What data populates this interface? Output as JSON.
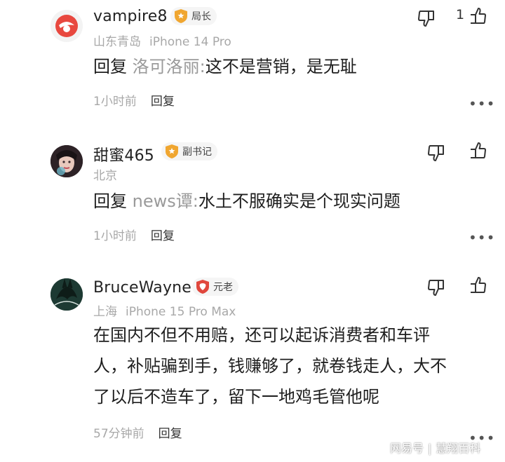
{
  "comments": [
    {
      "username": "vampire8",
      "badge": "局长",
      "location": "山东青岛",
      "device": "iPhone 14 Pro",
      "reply_prefix": "回复",
      "reply_target": "洛可洛丽:",
      "text": "这不是营销，是无耻",
      "time": "1小时前",
      "reply_label": "回复",
      "likes": "1"
    },
    {
      "username": "甜蜜465",
      "badge": "副书记",
      "location": "北京",
      "reply_prefix": "回复",
      "reply_target": "news谭:",
      "text": "水土不服确实是个现实问题",
      "time": "1小时前",
      "reply_label": "回复"
    },
    {
      "username": "BruceWayne",
      "badge": "元老",
      "location": "上海",
      "device": "iPhone 15 Pro Max",
      "lines": [
        "在国内不但不用赔，还可以起诉消费者和车评",
        "人，补贴骗到手，钱赚够了，就卷钱走人，大不",
        "了以后不造车了，留下一地鸡毛管他呢"
      ],
      "time": "57分钟前",
      "reply_label": "回复"
    }
  ],
  "more_label": "•••",
  "watermark": {
    "brand": "网易号",
    "sep": "|",
    "account": "慧翔百科"
  },
  "colors": {
    "badge_gold": "#f0a630",
    "badge_red": "#e0473d",
    "meta_gray": "#a8a8a8"
  }
}
